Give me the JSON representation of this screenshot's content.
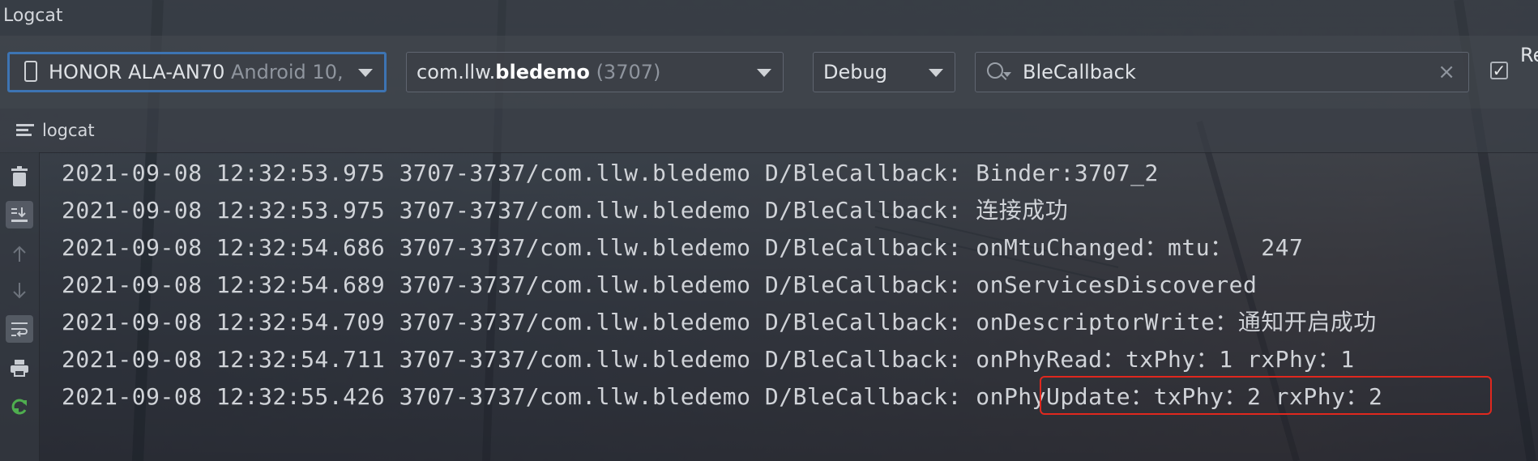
{
  "window": {
    "title": "Logcat"
  },
  "toolbar": {
    "device": {
      "name": "HONOR ALA-AN70",
      "detail": "Android 10,"
    },
    "process": {
      "prefix": "com.llw.",
      "bold": "bledemo",
      "pid": "(3707)"
    },
    "log_level": "Debug",
    "search": {
      "value": "BleCallback",
      "clear_glyph": "×"
    },
    "regex": {
      "checked": true,
      "check_glyph": "✓",
      "label": "Re"
    }
  },
  "tab": {
    "label": "logcat"
  },
  "log_lines": [
    "2021-09-08 12:32:53.975 3707-3737/com.llw.bledemo D/BleCallback: Binder:3707_2",
    "2021-09-08 12:32:53.975 3707-3737/com.llw.bledemo D/BleCallback: 连接成功",
    "2021-09-08 12:32:54.686 3707-3737/com.llw.bledemo D/BleCallback: onMtuChanged：mtu：  247",
    "2021-09-08 12:32:54.689 3707-3737/com.llw.bledemo D/BleCallback: onServicesDiscovered",
    "2021-09-08 12:32:54.709 3707-3737/com.llw.bledemo D/BleCallback: onDescriptorWrite：通知开启成功",
    "2021-09-08 12:32:54.711 3707-3737/com.llw.bledemo D/BleCallback: onPhyRead：txPhy：1 rxPhy：1",
    "2021-09-08 12:32:55.426 3707-3737/com.llw.bledemo D/BleCallback: onPhyUpdate：txPhy：2 rxPhy：2"
  ],
  "annotation": {
    "color": "#e0281e"
  },
  "colors": {
    "accent": "#3d74b3",
    "restart_icon": "#4fae4f"
  }
}
